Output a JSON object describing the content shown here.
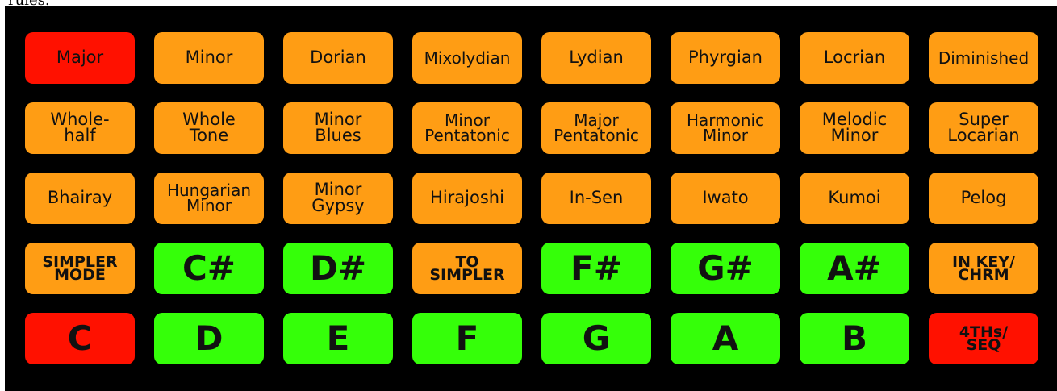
{
  "caption_fragment": "rules.",
  "colors": {
    "background": "#000000",
    "orange": "#ff9d14",
    "green": "#35ff09",
    "red": "#ff1100"
  },
  "rows": [
    [
      {
        "label": "Major",
        "color": "red"
      },
      {
        "label": "Minor",
        "color": "orange"
      },
      {
        "label": "Dorian",
        "color": "orange"
      },
      {
        "label": "Mixolydian",
        "color": "orange"
      },
      {
        "label": "Lydian",
        "color": "orange"
      },
      {
        "label": "Phyrgian",
        "color": "orange"
      },
      {
        "label": "Locrian",
        "color": "orange"
      },
      {
        "label": "Diminished",
        "color": "orange"
      }
    ],
    [
      {
        "label": "Whole-\nhalf",
        "color": "orange"
      },
      {
        "label": "Whole\nTone",
        "color": "orange"
      },
      {
        "label": "Minor\nBlues",
        "color": "orange"
      },
      {
        "label": "Minor\nPentatonic",
        "color": "orange"
      },
      {
        "label": "Major\nPentatonic",
        "color": "orange"
      },
      {
        "label": "Harmonic\nMinor",
        "color": "orange"
      },
      {
        "label": "Melodic\nMinor",
        "color": "orange"
      },
      {
        "label": "Super\nLocarian",
        "color": "orange"
      }
    ],
    [
      {
        "label": "Bhairay",
        "color": "orange"
      },
      {
        "label": "Hungarian\nMinor",
        "color": "orange"
      },
      {
        "label": "Minor\nGypsy",
        "color": "orange"
      },
      {
        "label": "Hirajoshi",
        "color": "orange"
      },
      {
        "label": "In-Sen",
        "color": "orange"
      },
      {
        "label": "Iwato",
        "color": "orange"
      },
      {
        "label": "Kumoi",
        "color": "orange"
      },
      {
        "label": "Pelog",
        "color": "orange"
      }
    ],
    [
      {
        "label": "SIMPLER\nMODE",
        "color": "orange"
      },
      {
        "label": "C#",
        "color": "green"
      },
      {
        "label": "D#",
        "color": "green"
      },
      {
        "label": "TO\nSIMPLER",
        "color": "orange"
      },
      {
        "label": "F#",
        "color": "green"
      },
      {
        "label": "G#",
        "color": "green"
      },
      {
        "label": "A#",
        "color": "green"
      },
      {
        "label": "IN KEY/\nCHRM",
        "color": "orange"
      }
    ],
    [
      {
        "label": "C",
        "color": "red"
      },
      {
        "label": "D",
        "color": "green"
      },
      {
        "label": "E",
        "color": "green"
      },
      {
        "label": "F",
        "color": "green"
      },
      {
        "label": "G",
        "color": "green"
      },
      {
        "label": "A",
        "color": "green"
      },
      {
        "label": "B",
        "color": "green"
      },
      {
        "label": "4THs/\nSEQ",
        "color": "red"
      }
    ]
  ]
}
